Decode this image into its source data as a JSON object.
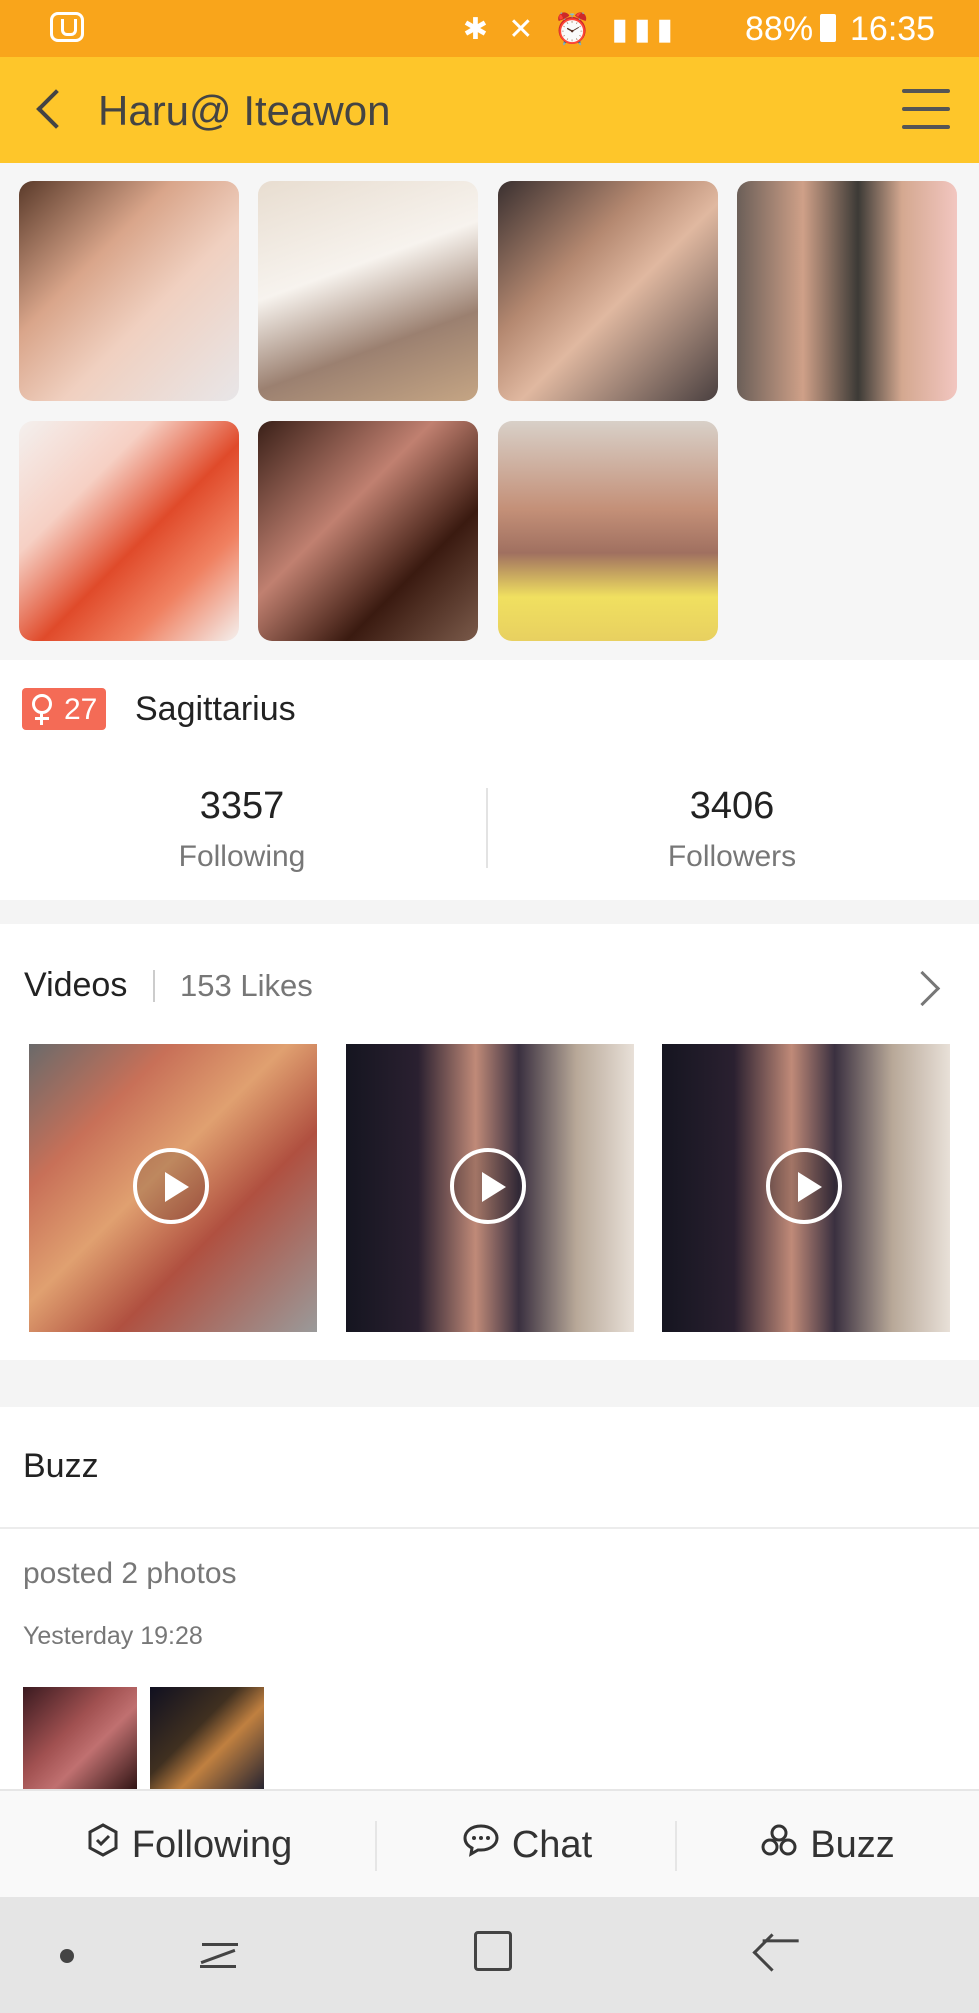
{
  "status_bar": {
    "battery": "88%",
    "time": "16:35",
    "icons": [
      "app-icon",
      "bluetooth-icon",
      "mute-icon",
      "alarm-icon",
      "lte-icon",
      "signal-icon",
      "battery-icon"
    ]
  },
  "header": {
    "title": "Haru@ Iteawon"
  },
  "profile": {
    "age": "27",
    "zodiac": "Sagittarius",
    "following_count": "3357",
    "following_label": "Following",
    "followers_count": "3406",
    "followers_label": "Followers"
  },
  "videos": {
    "title": "Videos",
    "likes": "153 Likes"
  },
  "buzz": {
    "title": "Buzz",
    "posted": "posted 2 photos",
    "time": "Yesterday 19:28"
  },
  "actions": {
    "following": "Following",
    "chat": "Chat",
    "buzz": "Buzz"
  },
  "colors": {
    "status_bar": "#f9a51b",
    "header": "#fec62a",
    "badge": "#f46b56"
  }
}
